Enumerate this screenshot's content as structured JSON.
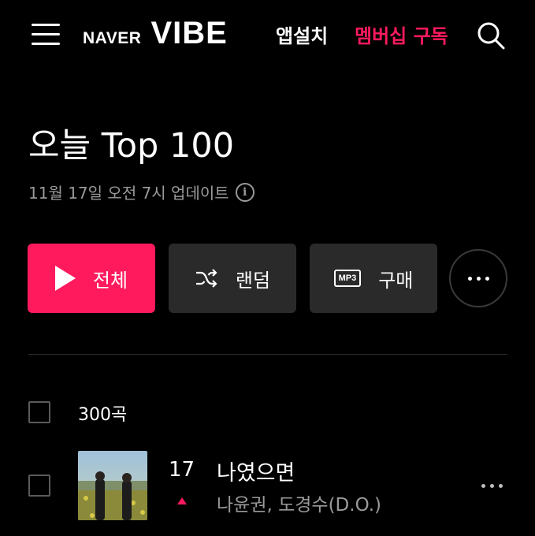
{
  "header": {
    "logo_naver": "NAVER",
    "logo_vibe": "VIBE",
    "app_install_label": "앱설치",
    "membership_label": "멤버십 구독",
    "menu_icon": "hamburger-menu-icon",
    "search_icon": "search-icon"
  },
  "page": {
    "title": "오늘 Top 100",
    "update_text": "11월 17일 오전 7시 업데이트",
    "info_icon": "info-icon",
    "info_glyph": "i"
  },
  "actions": {
    "play_all_label": "전체",
    "random_label": "랜덤",
    "buy_label": "구매",
    "mp3_badge": "MP3",
    "more_icon": "more-horizontal-icon"
  },
  "list": {
    "count_label": "300곡",
    "tracks": [
      {
        "rank": "17",
        "rank_change": "up",
        "title": "나였으면",
        "artist": "나윤권, 도경수(D.O.)"
      }
    ]
  },
  "colors": {
    "accent": "#ff1a5e",
    "background": "#000000",
    "button_dark": "#2a2a2a",
    "muted_text": "#9a9a9a"
  }
}
